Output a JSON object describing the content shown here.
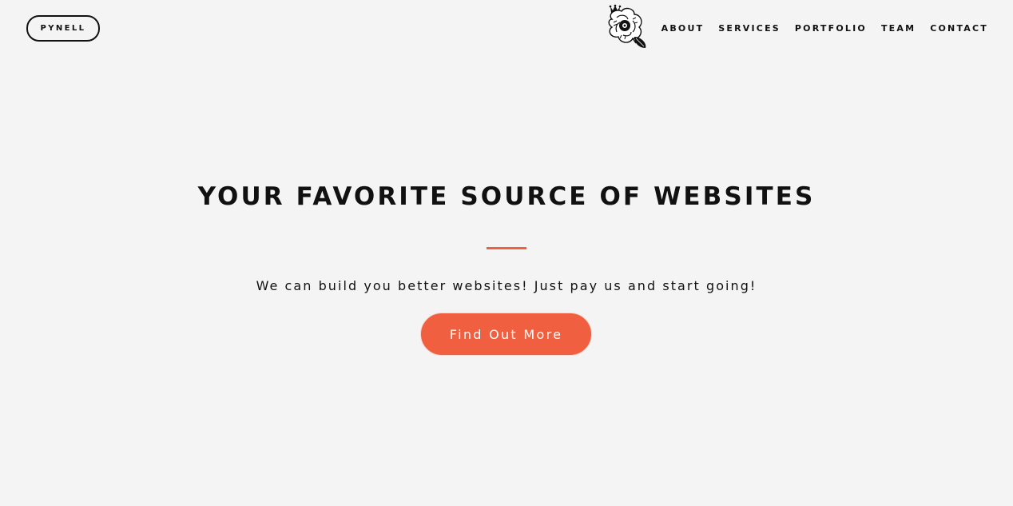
{
  "header": {
    "brand": "PYNELL",
    "logo_icon": "rose-flower-icon",
    "nav": [
      {
        "label": "ABOUT"
      },
      {
        "label": "SERVICES"
      },
      {
        "label": "PORTFOLIO"
      },
      {
        "label": "TEAM"
      },
      {
        "label": "CONTACT"
      }
    ]
  },
  "hero": {
    "title": "YOUR FAVORITE SOURCE OF WEBSITES",
    "subtitle": "We can build you better websites! Just pay us and start going!",
    "cta_label": "Find Out More"
  },
  "colors": {
    "background": "#f4f4f4",
    "accent": "#f05f40",
    "text": "#111111"
  }
}
